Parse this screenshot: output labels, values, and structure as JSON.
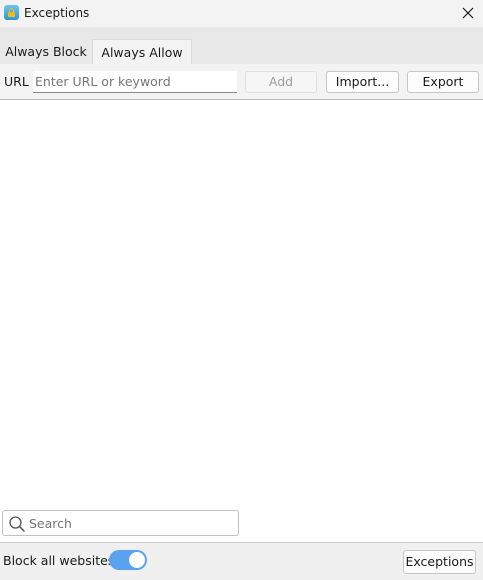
{
  "window": {
    "title": "Exceptions",
    "icon": "lock-app-icon",
    "close_icon": "close-icon"
  },
  "tabs": [
    {
      "label": "Always Block",
      "active": false
    },
    {
      "label": "Always Allow",
      "active": true
    }
  ],
  "toolbar": {
    "url_label": "URL",
    "url_value": "",
    "url_placeholder": "Enter URL or keyword",
    "add_label": "Add",
    "add_enabled": false,
    "import_label": "Import...",
    "export_label": "Export"
  },
  "list": {
    "items": []
  },
  "search": {
    "value": "",
    "placeholder": "Search",
    "icon": "search-icon"
  },
  "footer": {
    "block_all_label": "Block all websites",
    "block_all_enabled": true,
    "exceptions_label": "Exceptions"
  },
  "colors": {
    "accent": "#5aa2f0",
    "titlebar_bg": "#f3f3f3",
    "tabstrip_bg": "#e8e8e8",
    "disabled_text": "#9d9d9d"
  }
}
